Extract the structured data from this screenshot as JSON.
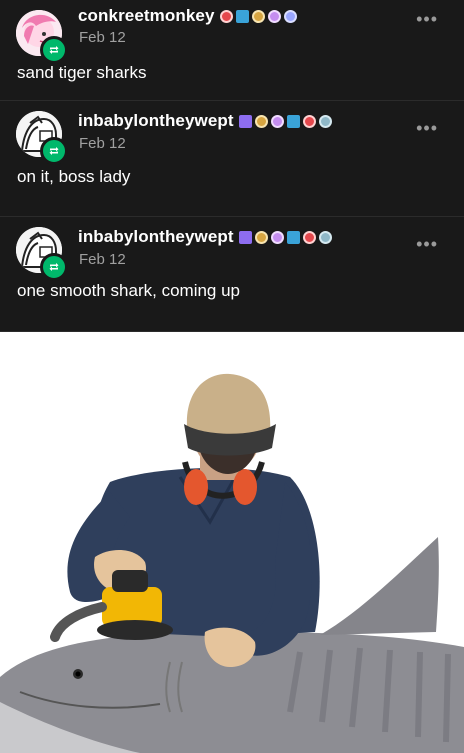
{
  "posts": [
    {
      "username": "conkreetmonkey",
      "date": "Feb 12",
      "text": "sand tiger sharks",
      "more_icon": "ellipsis-icon",
      "badge_colors": [
        "#e5484d",
        "#3aa3d8",
        "#d7a541",
        "#c58df0",
        "#9aa6ff"
      ]
    },
    {
      "username": "inbabylontheywept",
      "date": "Feb 12",
      "text": "on it, boss lady",
      "more_icon": "ellipsis-icon",
      "badge_colors": [
        "#8d6df0",
        "#d7a541",
        "#c58df0",
        "#3aa3d8",
        "#e5484d",
        "#8fb8c8"
      ]
    },
    {
      "username": "inbabylontheywept",
      "date": "Feb 12",
      "text": "one smooth shark, coming up",
      "more_icon": "ellipsis-icon",
      "badge_colors": [
        "#8d6df0",
        "#d7a541",
        "#c58df0",
        "#3aa3d8",
        "#e5484d",
        "#8fb8c8"
      ]
    }
  ],
  "image": {
    "subject": "man in cap and ear protectors using an orbital sander on a tiger shark"
  },
  "colors": {
    "background": "#191919",
    "date_text": "#a0a0a0",
    "reblog_green": "#00b86b"
  }
}
